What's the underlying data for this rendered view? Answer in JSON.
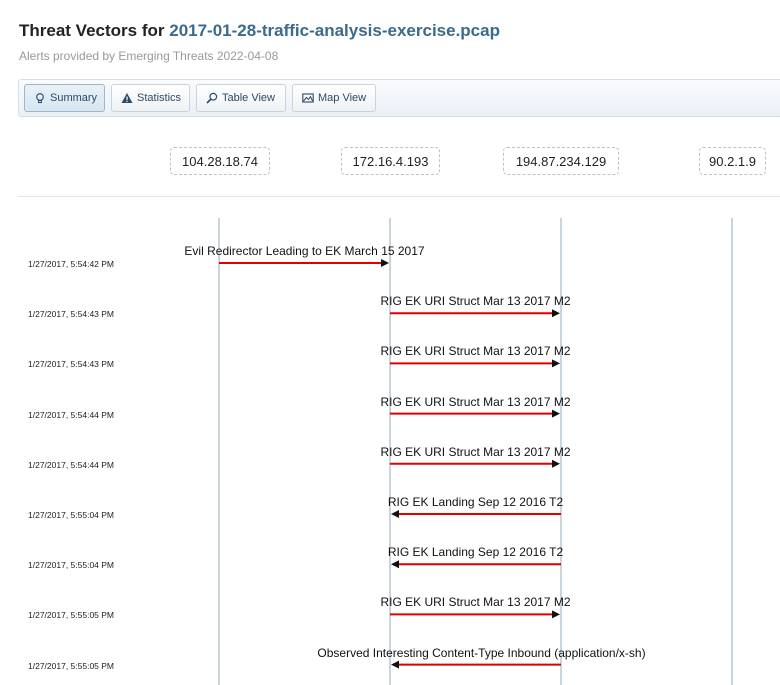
{
  "page": {
    "title_prefix": "Threat Vectors for",
    "filename": "2017-01-28-traffic-analysis-exercise.pcap",
    "subtitle": "Alerts provided by Emerging Threats 2022-04-08"
  },
  "tabs": [
    {
      "label": "Summary",
      "icon": "lightbulb-icon",
      "active": true
    },
    {
      "label": "Statistics",
      "icon": "warning-icon",
      "active": false
    },
    {
      "label": "Table View",
      "icon": "search-icon",
      "active": false
    },
    {
      "label": "Map View",
      "icon": "map-icon",
      "active": false
    }
  ],
  "hosts": [
    "104.28.18.74",
    "172.16.4.193",
    "194.87.234.129",
    "90.2.1.9"
  ],
  "events": [
    {
      "time": "1/27/2017, 5:54:42 PM",
      "label": "Evil Redirector Leading to EK March 15 2017",
      "from": 0,
      "to": 1
    },
    {
      "time": "1/27/2017, 5:54:43 PM",
      "label": "RIG EK URI Struct Mar 13 2017 M2",
      "from": 1,
      "to": 2
    },
    {
      "time": "1/27/2017, 5:54:43 PM",
      "label": "RIG EK URI Struct Mar 13 2017 M2",
      "from": 1,
      "to": 2
    },
    {
      "time": "1/27/2017, 5:54:44 PM",
      "label": "RIG EK URI Struct Mar 13 2017 M2",
      "from": 1,
      "to": 2
    },
    {
      "time": "1/27/2017, 5:54:44 PM",
      "label": "RIG EK URI Struct Mar 13 2017 M2",
      "from": 1,
      "to": 2
    },
    {
      "time": "1/27/2017, 5:55:04 PM",
      "label": "RIG EK Landing Sep 12 2016 T2",
      "from": 2,
      "to": 1
    },
    {
      "time": "1/27/2017, 5:55:04 PM",
      "label": "RIG EK Landing Sep 12 2016 T2",
      "from": 2,
      "to": 1
    },
    {
      "time": "1/27/2017, 5:55:05 PM",
      "label": "RIG EK URI Struct Mar 13 2017 M2",
      "from": 1,
      "to": 2
    },
    {
      "time": "1/27/2017, 5:55:05 PM",
      "label": "Observed Interesting Content-Type Inbound (application/x-sh)",
      "from": 2,
      "to": 1
    }
  ],
  "colors": {
    "arrow": "#e00000",
    "arrowhead": "#111111",
    "lifeline": "#c9d4dd",
    "filename": "#3a6b8c"
  }
}
